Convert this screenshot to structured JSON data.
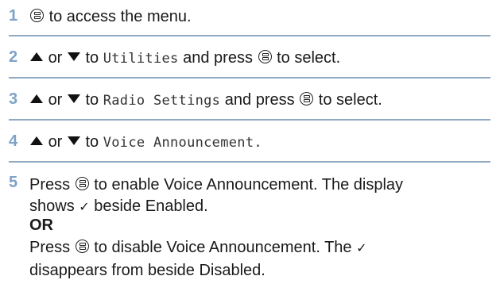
{
  "steps": [
    {
      "number": "1",
      "text_a": "to access the menu."
    },
    {
      "number": "2",
      "or_word": "or",
      "to_word": "to",
      "menu_item": "Utilities",
      "press_word": "and press",
      "tail": "to select."
    },
    {
      "number": "3",
      "or_word": "or",
      "to_word": "to",
      "menu_item": "Radio Settings",
      "press_word": "and press",
      "tail": "to select."
    },
    {
      "number": "4",
      "or_word": "or",
      "to_word": "to",
      "menu_item": "Voice Announcement",
      "tail": "."
    },
    {
      "number": "5",
      "press": "Press",
      "line1_tail": "to enable Voice Announcement. The display",
      "line2_a": "shows",
      "check": "✓",
      "line2_b": "beside Enabled.",
      "or_label": "OR",
      "line4_tail": "to disable Voice Announcement. The",
      "line5": "disappears from beside Disabled."
    }
  ],
  "icons": [
    "menu-ok-button-icon",
    "up-arrow-icon",
    "down-arrow-icon"
  ],
  "colors": {
    "step_number": "#7da3c6",
    "separator": "#8fa9c2"
  }
}
